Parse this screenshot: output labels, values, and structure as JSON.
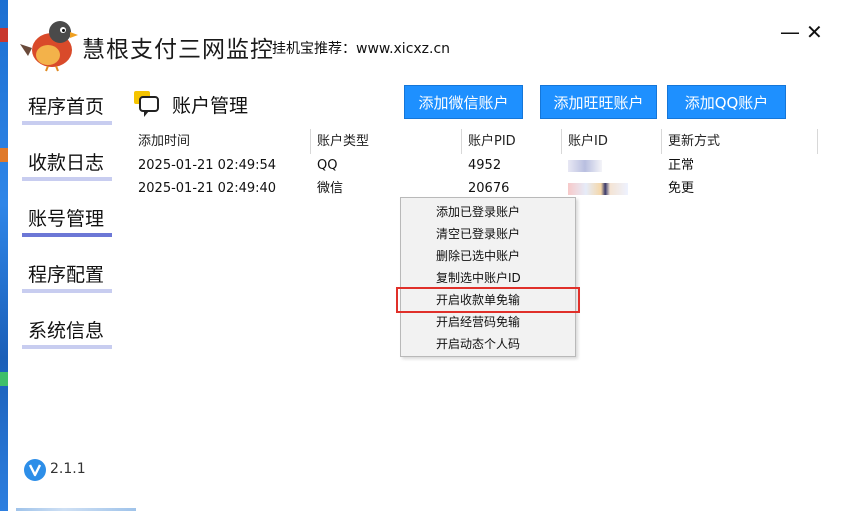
{
  "window": {
    "title": "慧根支付三网监控",
    "subtitle": "挂机宝推荐：www.xicxz.cn",
    "minimize_glyph": "—",
    "close_glyph": "✕"
  },
  "sidebar": {
    "items": [
      {
        "label": "程序首页"
      },
      {
        "label": "收款日志"
      },
      {
        "label": "账号管理"
      },
      {
        "label": "程序配置"
      },
      {
        "label": "系统信息"
      }
    ]
  },
  "section": {
    "title": "账户管理",
    "icon": "chat-bubble-icon"
  },
  "toolbar": {
    "add_wechat": "添加微信账户",
    "add_wangwang": "添加旺旺账户",
    "add_qq": "添加QQ账户"
  },
  "table": {
    "headers": [
      "添加时间",
      "账户类型",
      "账户PID",
      "账户ID",
      "更新方式"
    ],
    "rows": [
      {
        "time": "2025-01-21 02:49:54",
        "type": "QQ",
        "pid": "4952",
        "update": "正常"
      },
      {
        "time": "2025-01-21 02:49:40",
        "type": "微信",
        "pid": "20676",
        "update": "免更"
      }
    ]
  },
  "context_menu": {
    "items": [
      {
        "label": "添加已登录账户"
      },
      {
        "label": "清空已登录账户"
      },
      {
        "label": "删除已选中账户"
      },
      {
        "label": "复制选中账户ID"
      },
      {
        "label": "开启收款单免输"
      },
      {
        "label": "开启经营码免输"
      },
      {
        "label": "开启动态个人码"
      }
    ]
  },
  "version": {
    "label": "2.1.1",
    "icon": "v-badge-icon"
  },
  "colors": {
    "accent": "#1e90ff",
    "nav_underline": "#c8cdf0",
    "nav_active": "#6c77d6",
    "highlight": "#e0302a"
  }
}
